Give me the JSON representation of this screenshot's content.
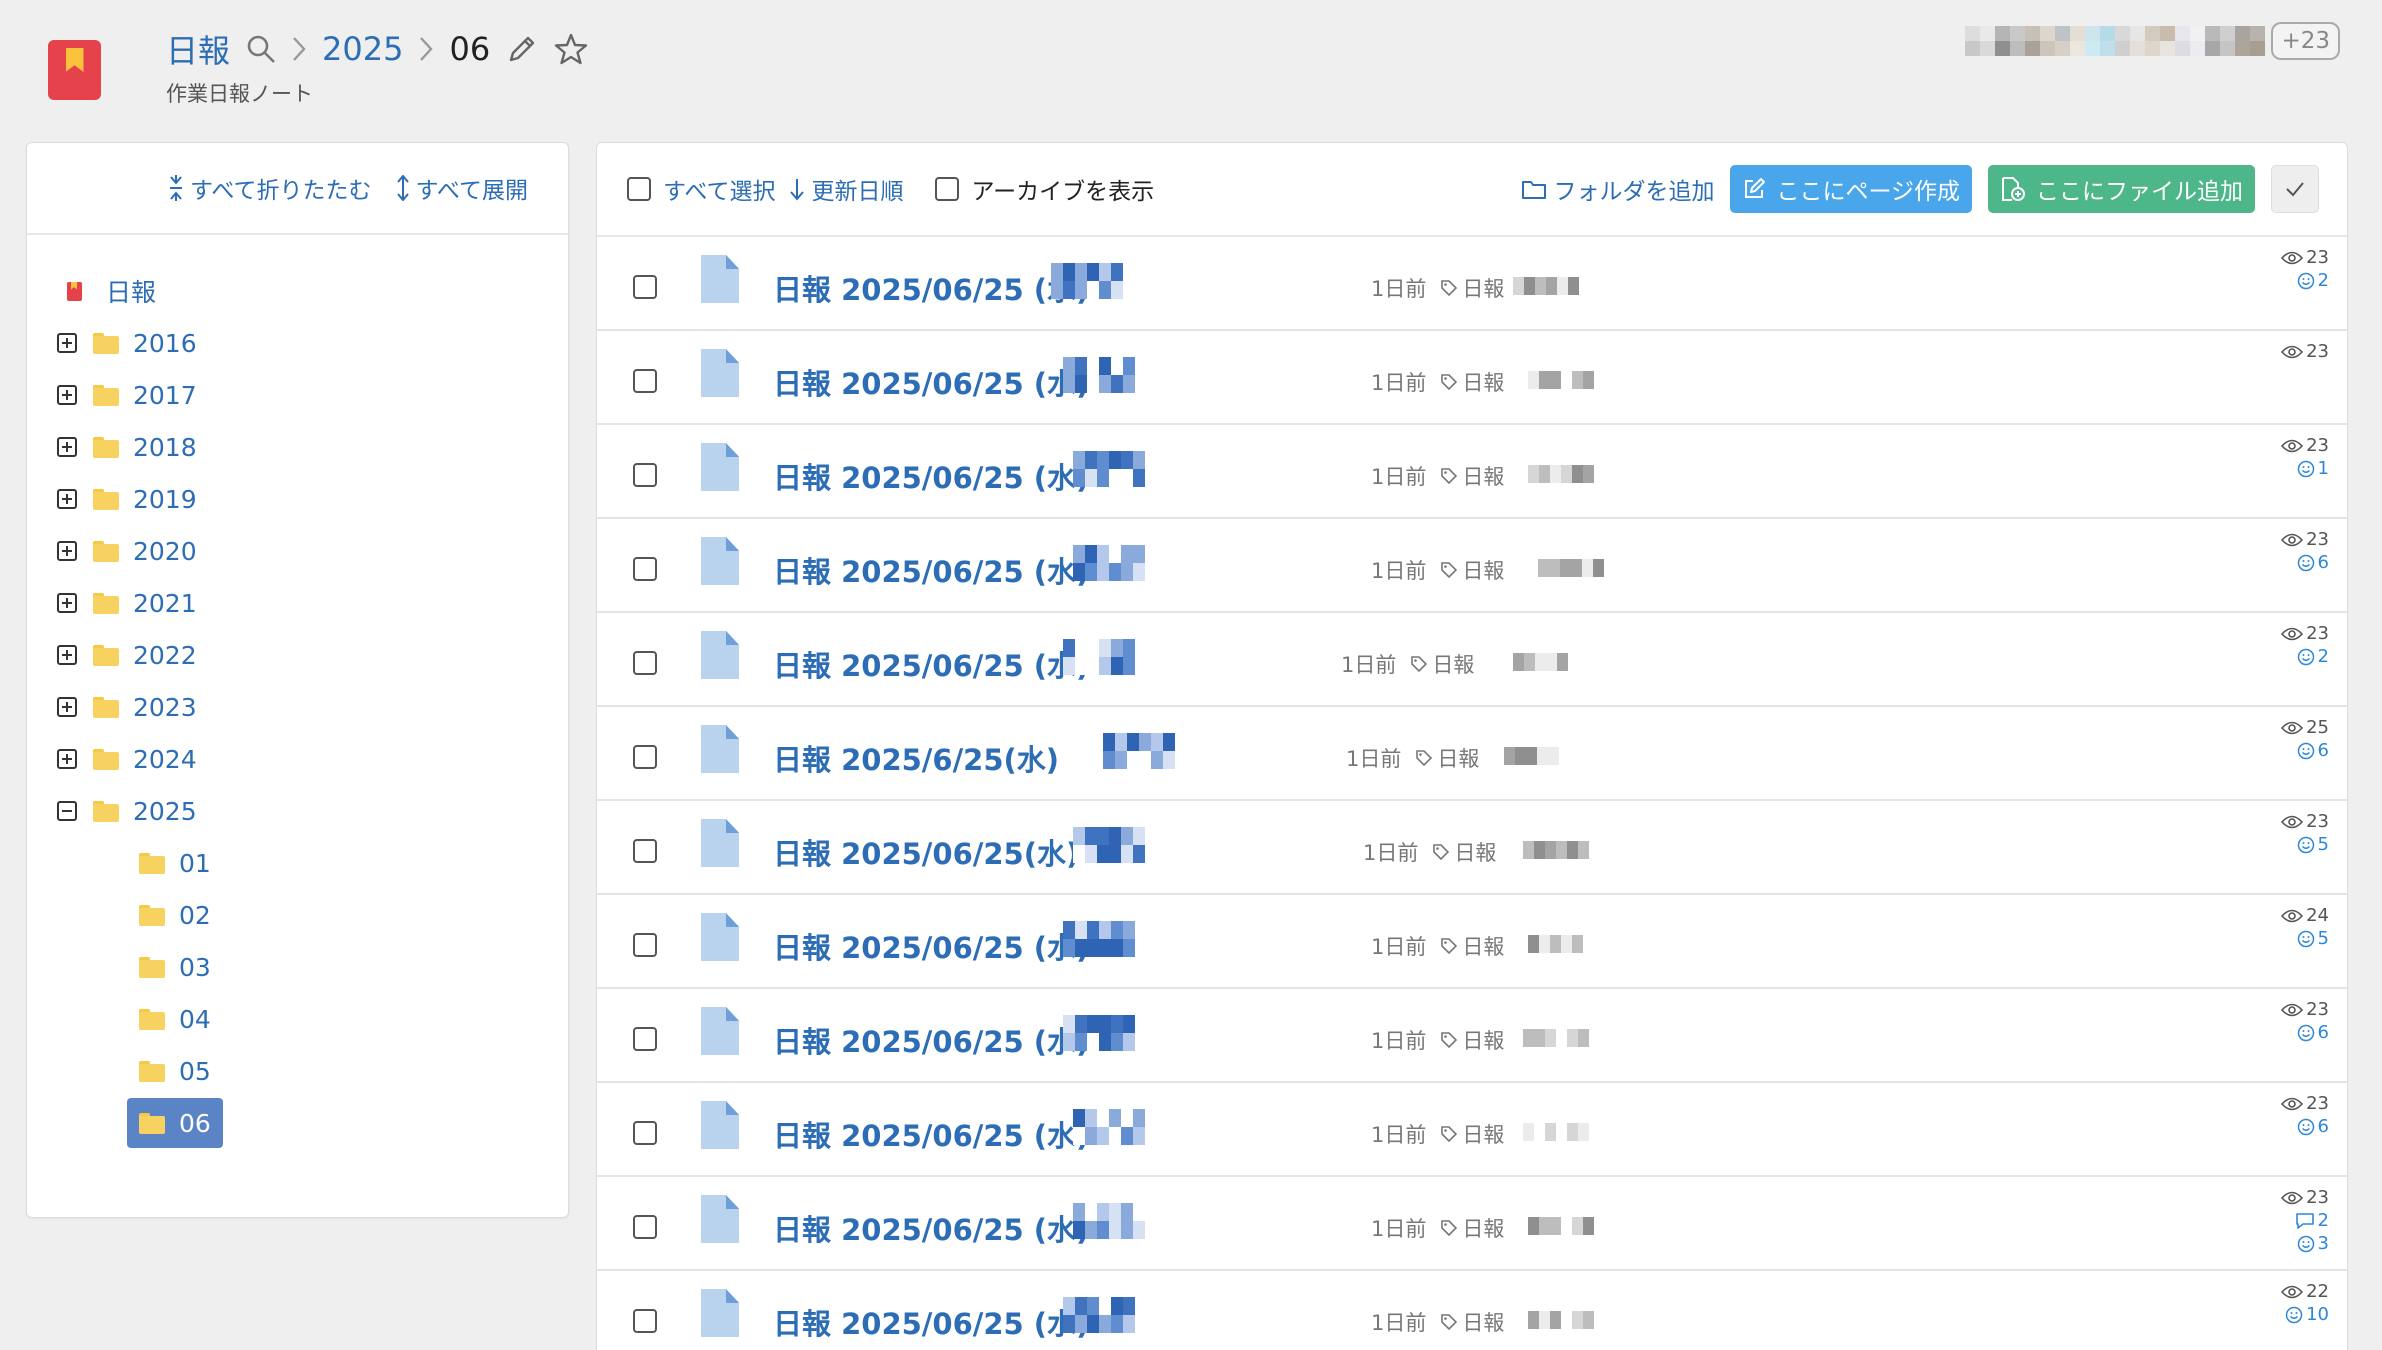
{
  "header": {
    "breadcrumb": [
      {
        "label": "日報",
        "type": "link"
      },
      {
        "label": "2025",
        "type": "link"
      },
      {
        "label": "06",
        "type": "current"
      }
    ],
    "subtitle": "作業日報ノート",
    "member_overflow": "+23"
  },
  "sidebar": {
    "collapse_all": "すべて折りたたむ",
    "expand_all": "すべて展開",
    "root": "日報",
    "years": [
      "2016",
      "2017",
      "2018",
      "2019",
      "2020",
      "2021",
      "2022",
      "2023",
      "2024"
    ],
    "open_year": "2025",
    "months": [
      "01",
      "02",
      "03",
      "04",
      "05",
      "06"
    ],
    "selected_month": "06"
  },
  "toolbar": {
    "select_all": "すべて選択",
    "sort": "更新日順",
    "show_archive": "アーカイブを表示",
    "add_folder": "フォルダを追加",
    "create_page": "ここにページ作成",
    "add_file": "ここにファイル追加"
  },
  "rows": [
    {
      "title": "日報 2025/06/25 (水)",
      "updated": "1日前",
      "tag": "日報",
      "views": "23",
      "reactions": "2",
      "comments": ""
    },
    {
      "title": "日報 2025/06/25 (水)",
      "updated": "1日前",
      "tag": "日報",
      "views": "23",
      "reactions": "",
      "comments": ""
    },
    {
      "title": "日報 2025/06/25 (水)",
      "updated": "1日前",
      "tag": "日報",
      "views": "23",
      "reactions": "1",
      "comments": ""
    },
    {
      "title": "日報 2025/06/25 (水)",
      "updated": "1日前",
      "tag": "日報",
      "views": "23",
      "reactions": "6",
      "comments": ""
    },
    {
      "title": "日報 2025/06/25 (水)",
      "updated": "1日前",
      "tag": "日報",
      "views": "23",
      "reactions": "2",
      "comments": ""
    },
    {
      "title": "日報 2025/6/25(水)",
      "updated": "1日前",
      "tag": "日報",
      "views": "25",
      "reactions": "6",
      "comments": ""
    },
    {
      "title": "日報 2025/06/25(水)",
      "updated": "1日前",
      "tag": "日報",
      "views": "23",
      "reactions": "5",
      "comments": ""
    },
    {
      "title": "日報 2025/06/25 (水)",
      "updated": "1日前",
      "tag": "日報",
      "views": "24",
      "reactions": "5",
      "comments": ""
    },
    {
      "title": "日報 2025/06/25 (水)",
      "updated": "1日前",
      "tag": "日報",
      "views": "23",
      "reactions": "6",
      "comments": ""
    },
    {
      "title": "日報 2025/06/25 (水)",
      "updated": "1日前",
      "tag": "日報",
      "views": "23",
      "reactions": "6",
      "comments": ""
    },
    {
      "title": "日報 2025/06/25 (水)",
      "updated": "1日前",
      "tag": "日報",
      "views": "23",
      "reactions": "3",
      "comments": "2"
    },
    {
      "title": "日報 2025/06/25 (水)",
      "updated": "1日前",
      "tag": "日報",
      "views": "22",
      "reactions": "10",
      "comments": ""
    }
  ],
  "colors": {
    "accent": "#2d6db5",
    "create_button": "#4aa6ea",
    "file_button": "#4db789",
    "logo": "#e5424b",
    "selected": "#5b84c7"
  }
}
